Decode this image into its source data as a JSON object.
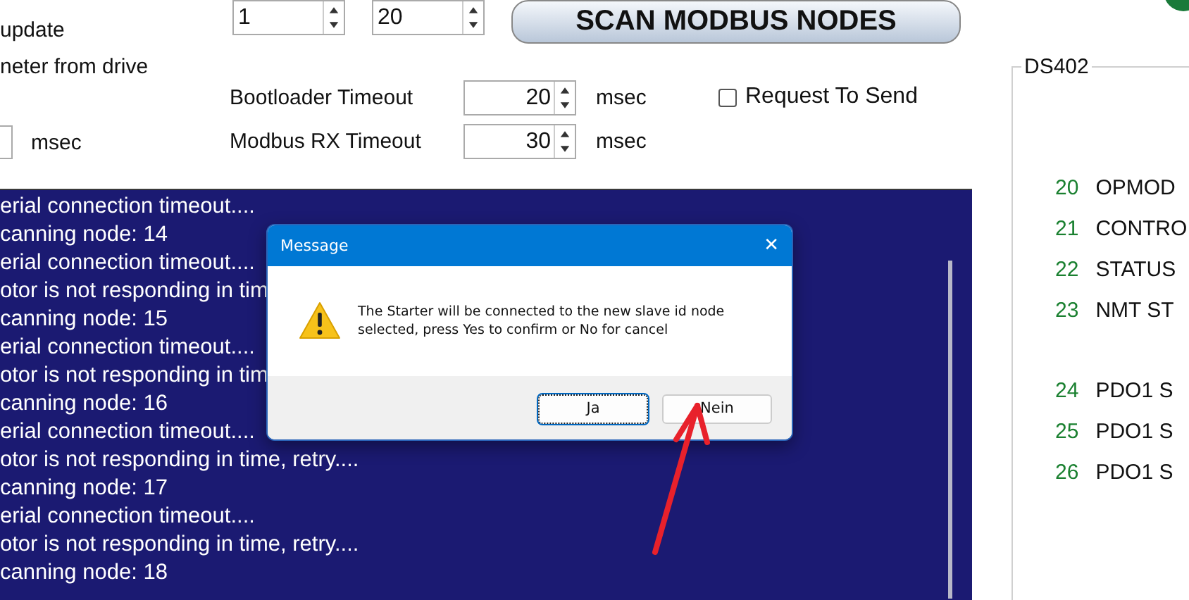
{
  "header_texts": [
    "update",
    "neter from drive"
  ],
  "left_timeout": {
    "unit": "msec"
  },
  "scan_range": [
    {
      "value": "1"
    },
    {
      "value": "20"
    }
  ],
  "scan_button": "SCAN MODBUS NODES",
  "timeouts": [
    {
      "label": "Bootloader Timeout",
      "value": "20",
      "unit": "msec"
    },
    {
      "label": "Modbus RX Timeout",
      "value": "30",
      "unit": "msec"
    }
  ],
  "request_to_send": {
    "label": "Request To Send",
    "checked": false
  },
  "log": [
    "erial connection timeout....",
    "canning node: 14",
    "erial connection timeout....",
    "otor is not responding in tim",
    "canning node: 15",
    "erial connection timeout....",
    "otor is not responding in tim",
    "canning node: 16",
    "erial connection timeout....",
    "otor is not responding in time, retry....",
    "canning node: 17",
    "erial connection timeout....",
    "otor is not responding in time, retry....",
    "canning node: 18"
  ],
  "ds402": {
    "title": "DS402",
    "rows": [
      {
        "number": "20",
        "label": "OPMOD"
      },
      {
        "number": "21",
        "label": "CONTRO"
      },
      {
        "number": "22",
        "label": "STATUS"
      },
      {
        "number": "23",
        "label": "NMT ST"
      },
      {
        "number": "24",
        "label": "PDO1 S"
      },
      {
        "number": "25",
        "label": "PDO1 S"
      },
      {
        "number": "26",
        "label": "PDO1 S"
      }
    ]
  },
  "dialog": {
    "title": "Message",
    "close": "✕",
    "message": "The Starter will be connected to the new slave id node selected, press Yes to confirm or No for cancel",
    "buttons": [
      {
        "label": "Ja",
        "focused": true
      },
      {
        "label": "Nein",
        "focused": false
      }
    ]
  }
}
